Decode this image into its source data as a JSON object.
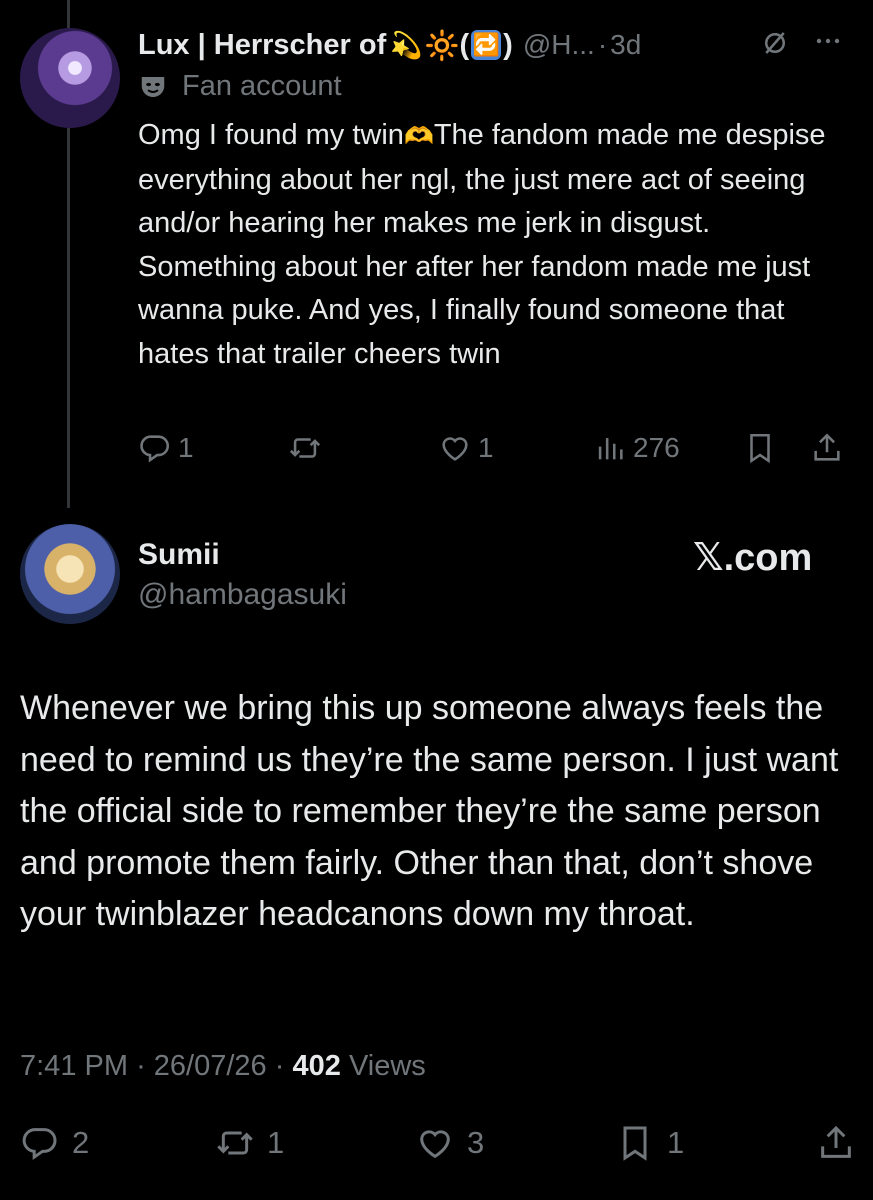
{
  "reply_tweet": {
    "author_name": "Lux | Herrscher of",
    "name_emoji_1": "💫",
    "name_emoji_2": "🔆",
    "name_paren_open": "(",
    "name_emoji_3": "🔁",
    "name_paren_close": ")",
    "handle": "@H...",
    "separator": "·",
    "time": "3d",
    "label": "Fan account",
    "text_before_emoji": "Omg I found my twin",
    "text_emoji": "🫶",
    "text_after_emoji": "The fandom made me despise everything about her ngl, the just mere act of seeing and/or hearing her makes me jerk in disgust. Something about her after her fandom made me just wanna puke. And yes, I finally found someone that hates that trailer cheers twin",
    "reply_count": "1",
    "repost_count": "",
    "like_count": "1",
    "view_count": "276"
  },
  "main_tweet": {
    "author_name": "Sumii",
    "handle": "@hambagasuki",
    "watermark": "𝕏.com",
    "text": "Whenever we bring this up someone always feels the need to remind us they’re the same person. I just want the official side to remember they’re the same person and promote them fairly. Other than that, don’t shove your twinblazer headcanons down my throat.",
    "time": "7:41 PM",
    "date": "26/07/26",
    "views_count": "402",
    "views_label": "Views",
    "dot": "·",
    "reply_count": "2",
    "repost_count": "1",
    "like_count": "3",
    "bookmark_count": "1"
  },
  "colors": {
    "background": "#000000",
    "text": "#e7e9ea",
    "muted": "#71767b",
    "thread_line": "#333639"
  }
}
